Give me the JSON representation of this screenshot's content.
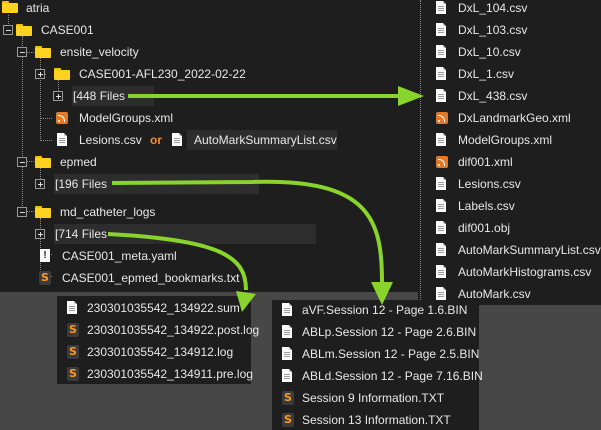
{
  "tree": {
    "root": "atria",
    "case": "CASE001",
    "ensite_folder": "ensite_velocity",
    "afl_folder": "CASE001-AFL230_2022-02-22",
    "afl_files": "[448 Files",
    "model_groups": "ModelGroups.xml",
    "lesions": "Lesions.csv",
    "or_text": "or",
    "auto_mark_summary": "AutoMarkSummaryList.csv",
    "epmed_folder": "epmed",
    "epmed_files": "[196 Files",
    "catheter_folder": "md_catheter_logs",
    "catheter_files": "[714 Files",
    "meta_yaml": "CASE001_meta.yaml",
    "bookmarks": "CASE001_epmed_bookmarks.txt"
  },
  "right_list": [
    "DxL_104.csv",
    "DxL_103.csv",
    "DxL_10.csv",
    "DxL_1.csv",
    "DxL_438.csv",
    "DxLandmarkGeo.xml",
    "ModelGroups.xml",
    "dif001.xml",
    "Lesions.csv",
    "Labels.csv",
    "dif001.obj",
    "AutoMarkSummaryList.csv",
    "AutoMarkHistograms.csv",
    "AutoMark.csv"
  ],
  "bottom_left_list": [
    "230301035542_134922.sum",
    "230301035542_134922.post.log",
    "230301035542_134912.log",
    "230301035542_134911.pre.log"
  ],
  "bottom_mid_list": [
    "aVF.Session 12 - Page 1.6.BIN",
    "ABLp.Session 12 - Page 2.6.BIN",
    "ABLm.Session 12 - Page 2.5.BIN",
    "ABLd.Session 12 - Page 7.16.BIN",
    "Session 9 Information.TXT",
    "Session 13 Information.TXT"
  ],
  "colors": {
    "arrow": "#88d42c",
    "panel": "#1e1e1e",
    "background": "#474747",
    "or_text": "#ff8c1a"
  },
  "icons": {
    "right_list": [
      "document-icon",
      "document-icon",
      "document-icon",
      "document-icon",
      "document-icon",
      "rss-file-icon",
      "document-icon",
      "rss-file-icon",
      "document-icon",
      "document-icon",
      "document-icon",
      "document-icon",
      "document-icon",
      "document-icon"
    ],
    "bottom_left_list": [
      "document-icon",
      "sublime-file-icon",
      "sublime-file-icon",
      "sublime-file-icon"
    ],
    "bottom_mid_list": [
      "document-icon",
      "document-icon",
      "document-icon",
      "document-icon",
      "sublime-file-icon",
      "sublime-file-icon"
    ]
  }
}
